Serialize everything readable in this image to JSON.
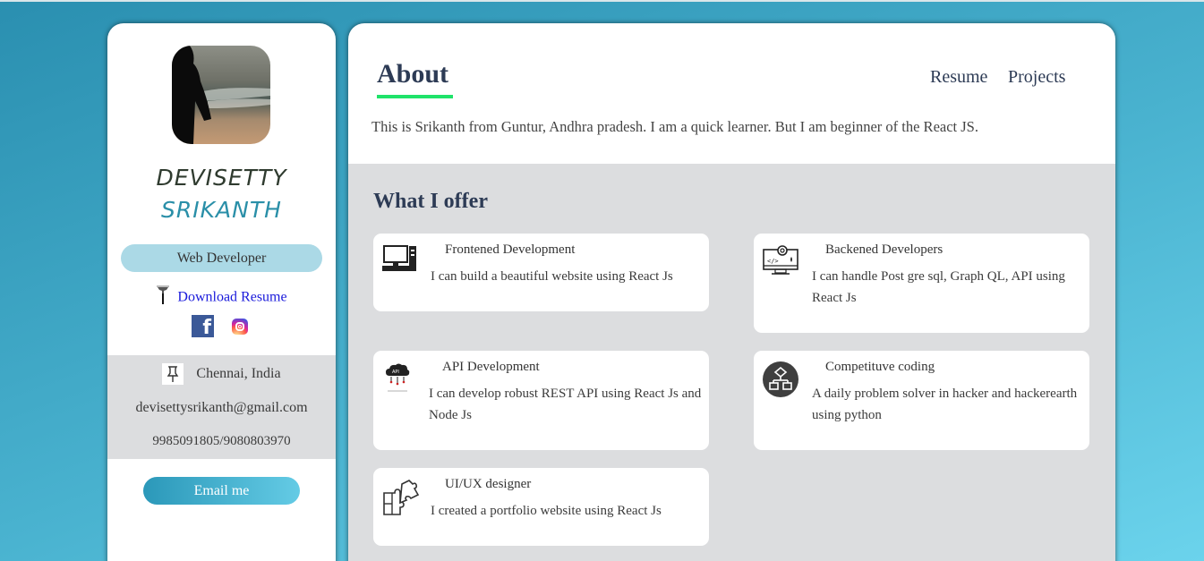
{
  "profile": {
    "first_name": "DEVISETTY",
    "last_name": "SRIKANTH",
    "role": "Web Developer",
    "download_label": "Download Resume",
    "location": "Chennai, India",
    "email": "devisettysrikanth@gmail.com",
    "phone": "9985091805/9080803970",
    "email_button": "Email me",
    "social_icons": [
      "facebook-icon",
      "instagram-icon"
    ]
  },
  "header": {
    "title": "About",
    "nav": [
      "Resume",
      "Projects"
    ],
    "intro": "This is Srikanth from Guntur, Andhra pradesh. I am a quick learner. But I am beginner of the React JS."
  },
  "offer": {
    "title": "What I offer",
    "services": [
      {
        "title": "Frontened Development",
        "desc": "I can build a beautiful website using React Js",
        "icon": "desktop-computer-icon"
      },
      {
        "title": "Backened Developers",
        "desc": "I can handle Post gre sql, Graph QL, API using React Js",
        "icon": "monitor-gear-code-icon"
      },
      {
        "title": "API Development",
        "desc": "I can develop robust REST API using React Js and Node Js",
        "icon": "api-cloud-icon"
      },
      {
        "title": "Competituve coding",
        "desc": "A daily problem solver in hacker and hackerearth using python",
        "icon": "flowchart-icon"
      },
      {
        "title": "UI/UX designer",
        "desc": "I created a portfolio website using React Js",
        "icon": "puzzle-icon"
      }
    ]
  },
  "colors": {
    "accent_underline": "#1fe36a",
    "name_accent": "#2a8fa8",
    "role_badge": "#abd9e6",
    "link": "#1a1adb"
  }
}
